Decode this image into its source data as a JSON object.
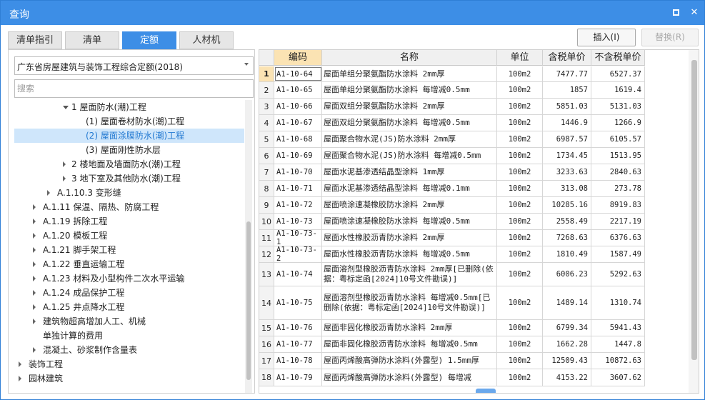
{
  "window": {
    "title": "查询"
  },
  "tabs": [
    {
      "label": "清单指引",
      "active": false
    },
    {
      "label": "清单",
      "active": false
    },
    {
      "label": "定额",
      "active": true
    },
    {
      "label": "人材机",
      "active": false
    }
  ],
  "actions": {
    "insert_label": "插入(I)",
    "replace_label": "替换(R)"
  },
  "left": {
    "selected_quota_book": "广东省房屋建筑与装饰工程综合定额(2018)",
    "search_placeholder": "搜索",
    "tree": [
      {
        "label": "1 屋面防水(潮)工程",
        "toggle": "down",
        "selected": false
      },
      {
        "label": "(1) 屋面卷材防水(潮)工程",
        "toggle": "none",
        "selected": false
      },
      {
        "label": "(2) 屋面涂膜防水(潮)工程",
        "toggle": "none",
        "selected": true
      },
      {
        "label": "(3) 屋面刚性防水层",
        "toggle": "none",
        "selected": false
      },
      {
        "label": "2 楼地面及墙面防水(潮)工程",
        "toggle": "right",
        "selected": false
      },
      {
        "label": "3 地下室及其他防水(潮)工程",
        "toggle": "right",
        "selected": false
      },
      {
        "label": "A.1.10.3 变形缝",
        "toggle": "right",
        "selected": false
      },
      {
        "label": "A.1.11 保温、隔热、防腐工程",
        "toggle": "right",
        "selected": false
      },
      {
        "label": "A.1.19 拆除工程",
        "toggle": "right",
        "selected": false
      },
      {
        "label": "A.1.20 模板工程",
        "toggle": "right",
        "selected": false
      },
      {
        "label": "A.1.21 脚手架工程",
        "toggle": "right",
        "selected": false
      },
      {
        "label": "A.1.22 垂直运输工程",
        "toggle": "right",
        "selected": false
      },
      {
        "label": "A.1.23 材料及小型构件二次水平运输",
        "toggle": "right",
        "selected": false
      },
      {
        "label": "A.1.24 成品保护工程",
        "toggle": "right",
        "selected": false
      },
      {
        "label": "A.1.25 井点降水工程",
        "toggle": "right",
        "selected": false
      },
      {
        "label": "建筑物超高增加人工、机械",
        "toggle": "right",
        "selected": false
      },
      {
        "label": "单独计算的费用",
        "toggle": "none",
        "selected": false
      },
      {
        "label": "混凝土、砂浆制作含量表",
        "toggle": "right",
        "selected": false
      },
      {
        "label": "装饰工程",
        "toggle": "right",
        "selected": false
      },
      {
        "label": "园林建筑",
        "toggle": "right",
        "selected": false
      }
    ]
  },
  "table": {
    "columns": [
      "编码",
      "名称",
      "单位",
      "含税单价",
      "不含税单价"
    ],
    "rows": [
      {
        "no": "1",
        "code": "A1-10-64",
        "name": "屋面单组分聚氨酯防水涂料 2mm厚",
        "unit": "100m2",
        "price_tax": "7477.77",
        "price_notax": "6527.37",
        "selected": true
      },
      {
        "no": "2",
        "code": "A1-10-65",
        "name": "屋面单组分聚氨酯防水涂料 每增减0.5mm",
        "unit": "100m2",
        "price_tax": "1857",
        "price_notax": "1619.4"
      },
      {
        "no": "3",
        "code": "A1-10-66",
        "name": "屋面双组分聚氨酯防水涂料 2mm厚",
        "unit": "100m2",
        "price_tax": "5851.03",
        "price_notax": "5131.03"
      },
      {
        "no": "4",
        "code": "A1-10-67",
        "name": "屋面双组分聚氨酯防水涂料 每增减0.5mm",
        "unit": "100m2",
        "price_tax": "1446.9",
        "price_notax": "1266.9"
      },
      {
        "no": "5",
        "code": "A1-10-68",
        "name": "屋面聚合物水泥(JS)防水涂料 2mm厚",
        "unit": "100m2",
        "price_tax": "6987.57",
        "price_notax": "6105.57"
      },
      {
        "no": "6",
        "code": "A1-10-69",
        "name": "屋面聚合物水泥(JS)防水涂料 每增减0.5mm",
        "unit": "100m2",
        "price_tax": "1734.45",
        "price_notax": "1513.95"
      },
      {
        "no": "7",
        "code": "A1-10-70",
        "name": "屋面水泥基渗透结晶型涂料 1mm厚",
        "unit": "100m2",
        "price_tax": "3233.63",
        "price_notax": "2840.63"
      },
      {
        "no": "8",
        "code": "A1-10-71",
        "name": "屋面水泥基渗透结晶型涂料 每增减0.1mm",
        "unit": "100m2",
        "price_tax": "313.08",
        "price_notax": "273.78"
      },
      {
        "no": "9",
        "code": "A1-10-72",
        "name": "屋面喷涂速凝橡胶防水涂料 2mm厚",
        "unit": "100m2",
        "price_tax": "10285.16",
        "price_notax": "8919.83"
      },
      {
        "no": "10",
        "code": "A1-10-73",
        "name": "屋面喷涂速凝橡胶防水涂料 每增减0.5mm",
        "unit": "100m2",
        "price_tax": "2558.49",
        "price_notax": "2217.19"
      },
      {
        "no": "11",
        "code": "A1-10-73-1",
        "name": "屋面水性橡胶沥青防水涂料 2mm厚",
        "unit": "100m2",
        "price_tax": "7268.63",
        "price_notax": "6376.63"
      },
      {
        "no": "12",
        "code": "A1-10-73-2",
        "name": "屋面水性橡胶沥青防水涂料 每增减0.5mm",
        "unit": "100m2",
        "price_tax": "1810.49",
        "price_notax": "1587.49"
      },
      {
        "no": "13",
        "code": "A1-10-74",
        "name": "屋面溶剂型橡胶沥青防水涂料 2mm厚[已删除(依据：粤标定函[2024]10号文件勘误)]",
        "unit": "100m2",
        "price_tax": "6006.23",
        "price_notax": "5292.63"
      },
      {
        "no": "14",
        "code": "A1-10-75",
        "name": "屋面溶剂型橡胶沥青防水涂料 每增减0.5mm[已删除(依据：粤标定函[2024]10号文件勘误)]",
        "unit": "100m2",
        "price_tax": "1489.14",
        "price_notax": "1310.74"
      },
      {
        "no": "15",
        "code": "A1-10-76",
        "name": "屋面非固化橡胶沥青防水涂料 2mm厚",
        "unit": "100m2",
        "price_tax": "6799.34",
        "price_notax": "5941.43"
      },
      {
        "no": "16",
        "code": "A1-10-77",
        "name": "屋面非固化橡胶沥青防水涂料 每增减0.5mm",
        "unit": "100m2",
        "price_tax": "1662.28",
        "price_notax": "1447.8"
      },
      {
        "no": "17",
        "code": "A1-10-78",
        "name": "屋面丙烯酸高弹防水涂料(外露型) 1.5mm厚",
        "unit": "100m2",
        "price_tax": "12509.43",
        "price_notax": "10872.63"
      },
      {
        "no": "18",
        "code": "A1-10-79",
        "name": "屋面丙烯酸高弹防水涂料(外露型) 每增减",
        "unit": "100m2",
        "price_tax": "4153.22",
        "price_notax": "3607.62"
      }
    ]
  }
}
